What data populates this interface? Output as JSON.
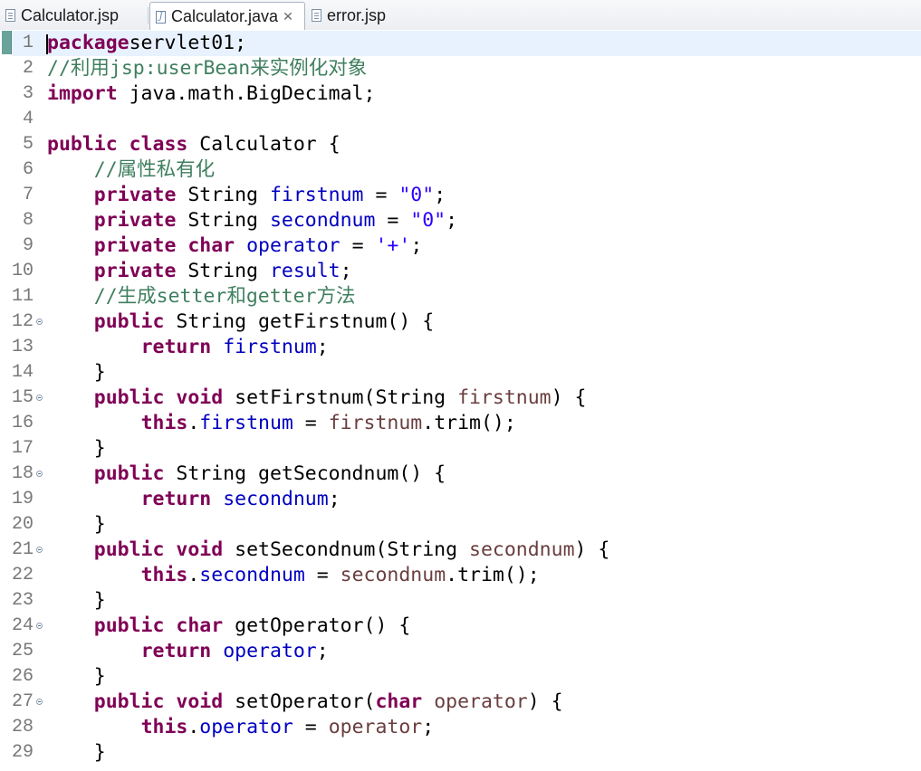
{
  "tabs": [
    {
      "label": "Calculator.jsp",
      "icon": "jsp-file-icon",
      "active": false
    },
    {
      "label": "Calculator.java",
      "icon": "java-file-icon",
      "active": true,
      "close": "✕"
    },
    {
      "label": "error.jsp",
      "icon": "jsp-file-icon",
      "active": false
    }
  ],
  "editor": {
    "lines": [
      {
        "n": "1",
        "fold": false,
        "tokens": [
          [
            "kw",
            "package"
          ],
          [
            "",
            "servlet01;"
          ]
        ]
      },
      {
        "n": "2",
        "fold": false,
        "tokens": [
          [
            "cm",
            "//利用jsp:userBean来实例化对象"
          ]
        ]
      },
      {
        "n": "3",
        "fold": false,
        "tokens": [
          [
            "kw",
            "import"
          ],
          [
            "",
            " java.math.BigDecimal;"
          ]
        ]
      },
      {
        "n": "4",
        "fold": false,
        "tokens": []
      },
      {
        "n": "5",
        "fold": false,
        "tokens": [
          [
            "kw",
            "public"
          ],
          [
            "",
            " "
          ],
          [
            "kw",
            "class"
          ],
          [
            "",
            " Calculator {"
          ]
        ]
      },
      {
        "n": "6",
        "fold": false,
        "tokens": [
          [
            "",
            "    "
          ],
          [
            "cm",
            "//属性私有化"
          ]
        ]
      },
      {
        "n": "7",
        "fold": false,
        "tokens": [
          [
            "",
            "    "
          ],
          [
            "kw",
            "private"
          ],
          [
            "",
            " String "
          ],
          [
            "fld",
            "firstnum"
          ],
          [
            "",
            " = "
          ],
          [
            "str",
            "\"0\""
          ],
          [
            "",
            ";"
          ]
        ]
      },
      {
        "n": "8",
        "fold": false,
        "tokens": [
          [
            "",
            "    "
          ],
          [
            "kw",
            "private"
          ],
          [
            "",
            " String "
          ],
          [
            "fld",
            "secondnum"
          ],
          [
            "",
            " = "
          ],
          [
            "str",
            "\"0\""
          ],
          [
            "",
            ";"
          ]
        ]
      },
      {
        "n": "9",
        "fold": false,
        "tokens": [
          [
            "",
            "    "
          ],
          [
            "kw",
            "private"
          ],
          [
            "",
            " "
          ],
          [
            "kw",
            "char"
          ],
          [
            "",
            " "
          ],
          [
            "fld",
            "operator"
          ],
          [
            "",
            " = "
          ],
          [
            "str",
            "'+'"
          ],
          [
            "",
            ";"
          ]
        ]
      },
      {
        "n": "10",
        "fold": false,
        "tokens": [
          [
            "",
            "    "
          ],
          [
            "kw",
            "private"
          ],
          [
            "",
            " String "
          ],
          [
            "fld",
            "result"
          ],
          [
            "",
            ";"
          ]
        ]
      },
      {
        "n": "11",
        "fold": false,
        "tokens": [
          [
            "",
            "    "
          ],
          [
            "cm",
            "//生成setter和getter方法"
          ]
        ]
      },
      {
        "n": "12",
        "fold": true,
        "tokens": [
          [
            "",
            "    "
          ],
          [
            "kw",
            "public"
          ],
          [
            "",
            " String getFirstnum() {"
          ]
        ]
      },
      {
        "n": "13",
        "fold": false,
        "tokens": [
          [
            "",
            "        "
          ],
          [
            "kw",
            "return"
          ],
          [
            "",
            " "
          ],
          [
            "fld",
            "firstnum"
          ],
          [
            "",
            ";"
          ]
        ]
      },
      {
        "n": "14",
        "fold": false,
        "tokens": [
          [
            "",
            "    }"
          ]
        ]
      },
      {
        "n": "15",
        "fold": true,
        "tokens": [
          [
            "",
            "    "
          ],
          [
            "kw",
            "public"
          ],
          [
            "",
            " "
          ],
          [
            "kw",
            "void"
          ],
          [
            "",
            " setFirstnum(String "
          ],
          [
            "prm",
            "firstnum"
          ],
          [
            "",
            ") {"
          ]
        ]
      },
      {
        "n": "16",
        "fold": false,
        "tokens": [
          [
            "",
            "        "
          ],
          [
            "kw",
            "this"
          ],
          [
            "",
            "."
          ],
          [
            "fld",
            "firstnum"
          ],
          [
            "",
            " = "
          ],
          [
            "prm",
            "firstnum"
          ],
          [
            "",
            ".trim();"
          ]
        ]
      },
      {
        "n": "17",
        "fold": false,
        "tokens": [
          [
            "",
            "    }"
          ]
        ]
      },
      {
        "n": "18",
        "fold": true,
        "tokens": [
          [
            "",
            "    "
          ],
          [
            "kw",
            "public"
          ],
          [
            "",
            " String getSecondnum() {"
          ]
        ]
      },
      {
        "n": "19",
        "fold": false,
        "tokens": [
          [
            "",
            "        "
          ],
          [
            "kw",
            "return"
          ],
          [
            "",
            " "
          ],
          [
            "fld",
            "secondnum"
          ],
          [
            "",
            ";"
          ]
        ]
      },
      {
        "n": "20",
        "fold": false,
        "tokens": [
          [
            "",
            "    }"
          ]
        ]
      },
      {
        "n": "21",
        "fold": true,
        "tokens": [
          [
            "",
            "    "
          ],
          [
            "kw",
            "public"
          ],
          [
            "",
            " "
          ],
          [
            "kw",
            "void"
          ],
          [
            "",
            " setSecondnum(String "
          ],
          [
            "prm",
            "secondnum"
          ],
          [
            "",
            ") {"
          ]
        ]
      },
      {
        "n": "22",
        "fold": false,
        "tokens": [
          [
            "",
            "        "
          ],
          [
            "kw",
            "this"
          ],
          [
            "",
            "."
          ],
          [
            "fld",
            "secondnum"
          ],
          [
            "",
            " = "
          ],
          [
            "prm",
            "secondnum"
          ],
          [
            "",
            ".trim();"
          ]
        ]
      },
      {
        "n": "23",
        "fold": false,
        "tokens": [
          [
            "",
            "    }"
          ]
        ]
      },
      {
        "n": "24",
        "fold": true,
        "tokens": [
          [
            "",
            "    "
          ],
          [
            "kw",
            "public"
          ],
          [
            "",
            " "
          ],
          [
            "kw",
            "char"
          ],
          [
            "",
            " getOperator() {"
          ]
        ]
      },
      {
        "n": "25",
        "fold": false,
        "tokens": [
          [
            "",
            "        "
          ],
          [
            "kw",
            "return"
          ],
          [
            "",
            " "
          ],
          [
            "fld",
            "operator"
          ],
          [
            "",
            ";"
          ]
        ]
      },
      {
        "n": "26",
        "fold": false,
        "tokens": [
          [
            "",
            "    }"
          ]
        ]
      },
      {
        "n": "27",
        "fold": true,
        "tokens": [
          [
            "",
            "    "
          ],
          [
            "kw",
            "public"
          ],
          [
            "",
            " "
          ],
          [
            "kw",
            "void"
          ],
          [
            "",
            " setOperator("
          ],
          [
            "kw",
            "char"
          ],
          [
            "",
            " "
          ],
          [
            "prm",
            "operator"
          ],
          [
            "",
            ") {"
          ]
        ]
      },
      {
        "n": "28",
        "fold": false,
        "tokens": [
          [
            "",
            "        "
          ],
          [
            "kw",
            "this"
          ],
          [
            "",
            "."
          ],
          [
            "fld",
            "operator"
          ],
          [
            "",
            " = "
          ],
          [
            "prm",
            "operator"
          ],
          [
            "",
            ";"
          ]
        ]
      },
      {
        "n": "29",
        "fold": false,
        "tokens": [
          [
            "",
            "    }"
          ]
        ]
      }
    ]
  },
  "colors": {
    "keyword": "#7f0055",
    "comment": "#3f7f5f",
    "string": "#2a00ff",
    "field": "#0000c0",
    "parameter": "#6a3e3e",
    "current_line": "#e8f2fe"
  }
}
